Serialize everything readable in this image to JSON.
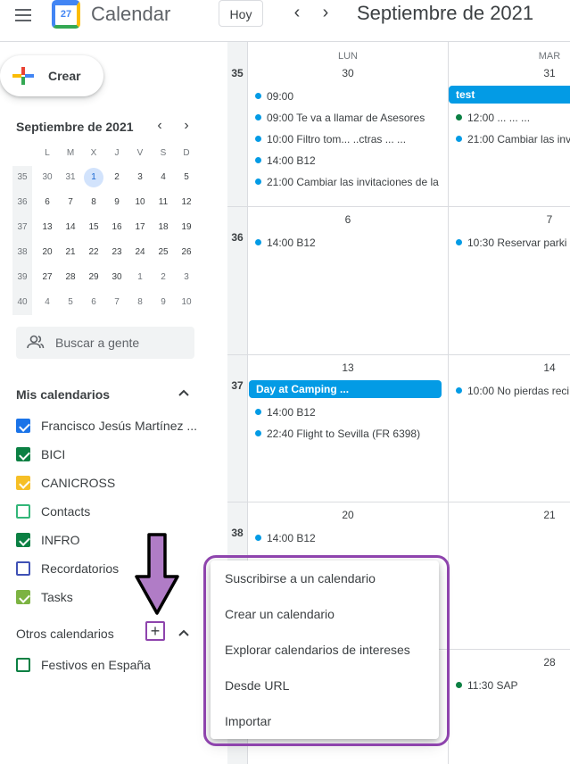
{
  "header": {
    "app_title": "Calendar",
    "logo_day": "27",
    "today_button": "Hoy",
    "prev_label": "‹",
    "next_label": "›",
    "month_title": "Septiembre de 2021"
  },
  "sidebar": {
    "create_label": "Crear",
    "mini_calendar": {
      "title": "Septiembre de 2021",
      "weekday_headers": [
        "L",
        "M",
        "X",
        "J",
        "V",
        "S",
        "D"
      ],
      "weeks": [
        {
          "num": "35",
          "days": [
            "30",
            "31",
            "1",
            "2",
            "3",
            "4",
            "5"
          ]
        },
        {
          "num": "36",
          "days": [
            "6",
            "7",
            "8",
            "9",
            "10",
            "11",
            "12"
          ]
        },
        {
          "num": "37",
          "days": [
            "13",
            "14",
            "15",
            "16",
            "17",
            "18",
            "19"
          ]
        },
        {
          "num": "38",
          "days": [
            "20",
            "21",
            "22",
            "23",
            "24",
            "25",
            "26"
          ]
        },
        {
          "num": "39",
          "days": [
            "27",
            "28",
            "29",
            "30",
            "1",
            "2",
            "3"
          ]
        },
        {
          "num": "40",
          "days": [
            "4",
            "5",
            "6",
            "7",
            "8",
            "9",
            "10"
          ]
        }
      ],
      "today": "1"
    },
    "search_people_placeholder": "Buscar a gente",
    "my_calendars_title": "Mis calendarios",
    "my_calendars": [
      {
        "label": "Francisco Jesús Martínez ...",
        "color": "#1a73e8",
        "checked": true
      },
      {
        "label": "BICI",
        "color": "#0b8043",
        "checked": true
      },
      {
        "label": "CANICROSS",
        "color": "#f6bf26",
        "checked": true
      },
      {
        "label": "Contacts",
        "color": "#33b679",
        "checked": false
      },
      {
        "label": "INFRO",
        "color": "#0b8043",
        "checked": true
      },
      {
        "label": "Recordatorios",
        "color": "#3f51b5",
        "checked": false
      },
      {
        "label": "Tasks",
        "color": "#7cb342",
        "checked": true
      }
    ],
    "other_calendars_title": "Otros calendarios",
    "other_calendars": [
      {
        "label": "Festivos en España",
        "color": "#0b8043",
        "checked": false
      }
    ]
  },
  "grid": {
    "col_headers": [
      {
        "day": "LUN",
        "num": "30"
      },
      {
        "day": "MAR",
        "num": "31"
      }
    ],
    "weeks": [
      {
        "num": "35",
        "mon": "30",
        "tue": "31",
        "mon_events": [
          {
            "time": "09:00",
            "title": ""
          },
          {
            "time": "09:00",
            "title": "Te va a llamar de Asesores"
          },
          {
            "time": "10:00",
            "title": "Filtro tom... ..ctras ... ..."
          },
          {
            "time": "14:00",
            "title": "B12"
          },
          {
            "time": "21:00",
            "title": "Cambiar las invitaciones de la"
          }
        ],
        "tue_chip": "test",
        "tue_events": [
          {
            "time": "12:00",
            "title": "... ... ...",
            "color": "#0b8043"
          },
          {
            "time": "21:00",
            "title": "Cambiar las inv",
            "color": "#039be5"
          }
        ]
      },
      {
        "num": "36",
        "mon": "6",
        "tue": "7",
        "mon_events": [
          {
            "time": "14:00",
            "title": "B12"
          }
        ],
        "tue_events": [
          {
            "time": "10:30",
            "title": "Reservar parki",
            "color": "#039be5"
          }
        ]
      },
      {
        "num": "37",
        "mon": "13",
        "tue": "14",
        "mon_chip": "Day at Camping ...",
        "mon_events": [
          {
            "time": "14:00",
            "title": "B12"
          },
          {
            "time": "22:40",
            "title": "Flight to Sevilla (FR 6398)"
          }
        ],
        "tue_events": [
          {
            "time": "10:00",
            "title": "No pierdas reci",
            "color": "#039be5"
          }
        ]
      },
      {
        "num": "38",
        "mon": "20",
        "tue": "21",
        "mon_events": [
          {
            "time": "14:00",
            "title": "B12"
          }
        ],
        "tue_events": []
      },
      {
        "num": "",
        "mon": "",
        "tue": "28",
        "tue_events": [
          {
            "time": "11:30",
            "title": "SAP",
            "color": "#0b8043"
          }
        ]
      }
    ]
  },
  "menu": {
    "items": [
      "Suscribirse a un calendario",
      "Crear un calendario",
      "Explorar calendarios de intereses",
      "Desde URL",
      "Importar"
    ]
  },
  "colors": {
    "event_blue": "#039be5",
    "chip_blue": "#039be5",
    "highlight": "#8e44ad"
  }
}
